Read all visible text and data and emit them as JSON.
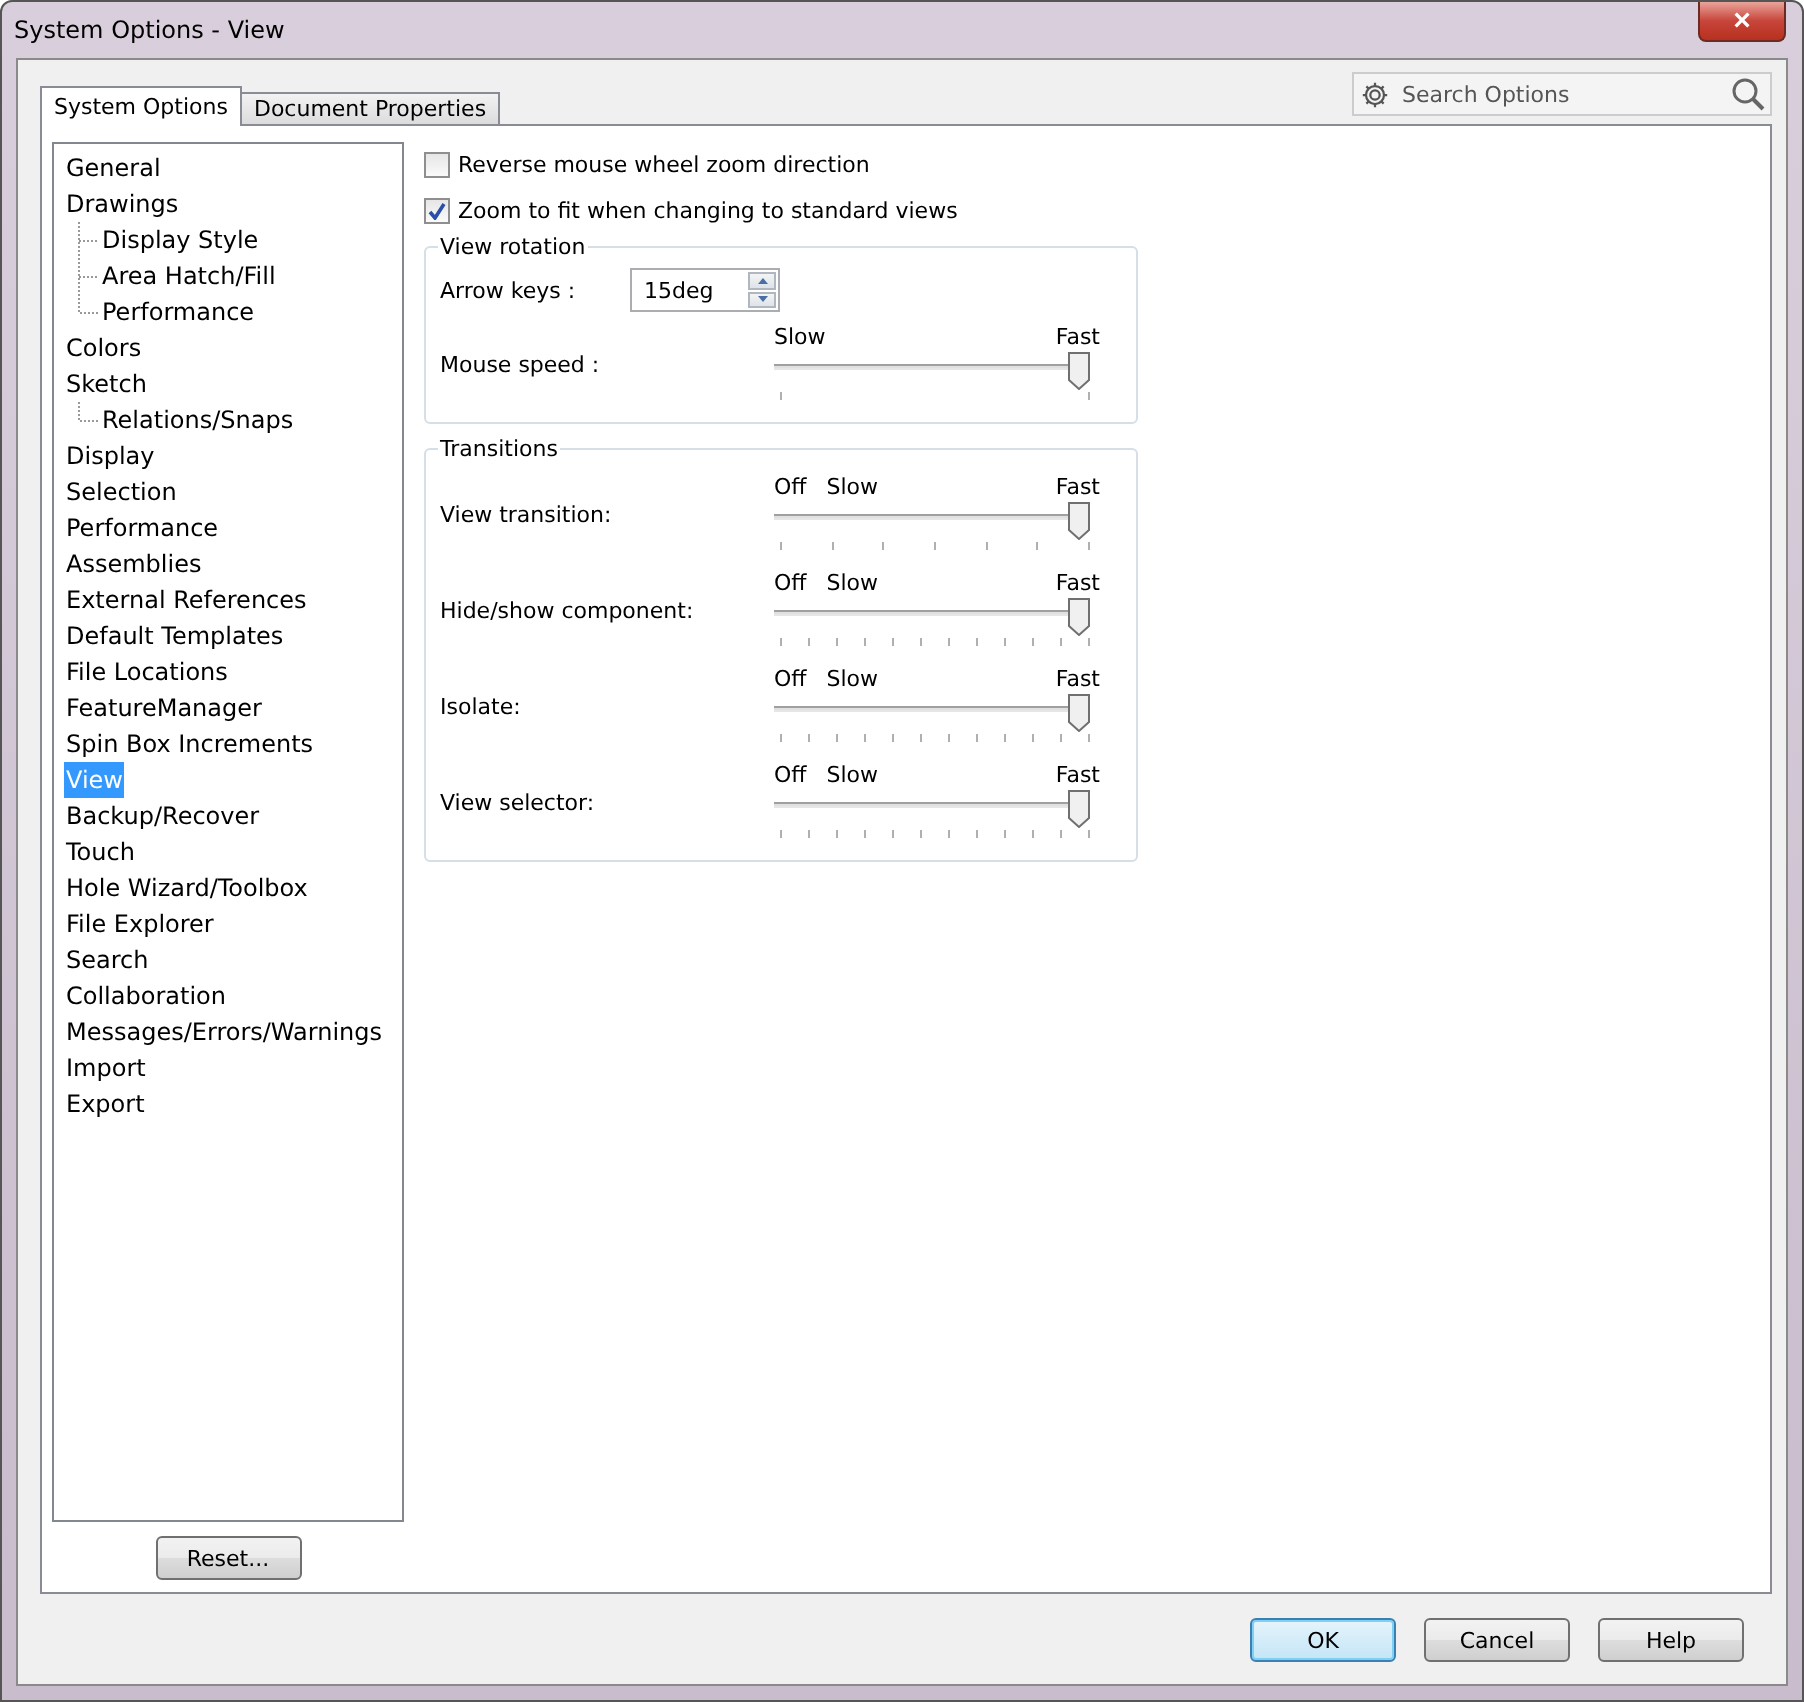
{
  "window": {
    "title": "System Options - View",
    "close": "×"
  },
  "tabs": [
    {
      "label": "System Options",
      "selected": true
    },
    {
      "label": "Document Properties",
      "selected": false
    }
  ],
  "search": {
    "placeholder": "Search Options"
  },
  "tree": [
    {
      "label": "General",
      "selected": false
    },
    {
      "label": "Drawings",
      "selected": false,
      "children": [
        {
          "label": "Display Style",
          "selected": false
        },
        {
          "label": "Area Hatch/Fill",
          "selected": false
        },
        {
          "label": "Performance",
          "selected": false
        }
      ]
    },
    {
      "label": "Colors",
      "selected": false
    },
    {
      "label": "Sketch",
      "selected": false,
      "children": [
        {
          "label": "Relations/Snaps",
          "selected": false
        }
      ]
    },
    {
      "label": "Display",
      "selected": false
    },
    {
      "label": "Selection",
      "selected": false
    },
    {
      "label": "Performance",
      "selected": false
    },
    {
      "label": "Assemblies",
      "selected": false
    },
    {
      "label": "External References",
      "selected": false
    },
    {
      "label": "Default Templates",
      "selected": false
    },
    {
      "label": "File Locations",
      "selected": false
    },
    {
      "label": "FeatureManager",
      "selected": false
    },
    {
      "label": "Spin Box Increments",
      "selected": false
    },
    {
      "label": "View",
      "selected": true
    },
    {
      "label": "Backup/Recover",
      "selected": false
    },
    {
      "label": "Touch",
      "selected": false
    },
    {
      "label": "Hole Wizard/Toolbox",
      "selected": false
    },
    {
      "label": "File Explorer",
      "selected": false
    },
    {
      "label": "Search",
      "selected": false
    },
    {
      "label": "Collaboration",
      "selected": false
    },
    {
      "label": "Messages/Errors/Warnings",
      "selected": false
    },
    {
      "label": "Import",
      "selected": false
    },
    {
      "label": "Export",
      "selected": false
    }
  ],
  "reset_button": "Reset...",
  "checkboxes": [
    {
      "label": "Reverse mouse wheel zoom direction",
      "checked": false
    },
    {
      "label": "Zoom to fit when changing to standard views",
      "checked": true
    }
  ],
  "view_rotation": {
    "title": "View rotation",
    "arrow_keys": {
      "label": "Arrow keys :",
      "value": "15deg"
    },
    "mouse_speed": {
      "label": "Mouse speed :",
      "marks": [
        "Slow",
        "Fast"
      ],
      "level": 1
    }
  },
  "transitions": {
    "title": "Transitions",
    "sliders": [
      {
        "label": "View transition:",
        "marks": [
          "Off",
          "Slow",
          "Fast"
        ],
        "level": 1
      },
      {
        "label": "Hide/show component:",
        "marks": [
          "Off",
          "Slow",
          "Fast"
        ],
        "level": 1
      },
      {
        "label": "Isolate:",
        "marks": [
          "Off",
          "Slow",
          "Fast"
        ],
        "level": 1
      },
      {
        "label": "View selector:",
        "marks": [
          "Off",
          "Slow",
          "Fast"
        ],
        "level": 1
      }
    ]
  },
  "buttons": [
    {
      "label": "OK",
      "default": true
    },
    {
      "label": "Cancel",
      "default": false
    },
    {
      "label": "Help",
      "default": false
    }
  ]
}
